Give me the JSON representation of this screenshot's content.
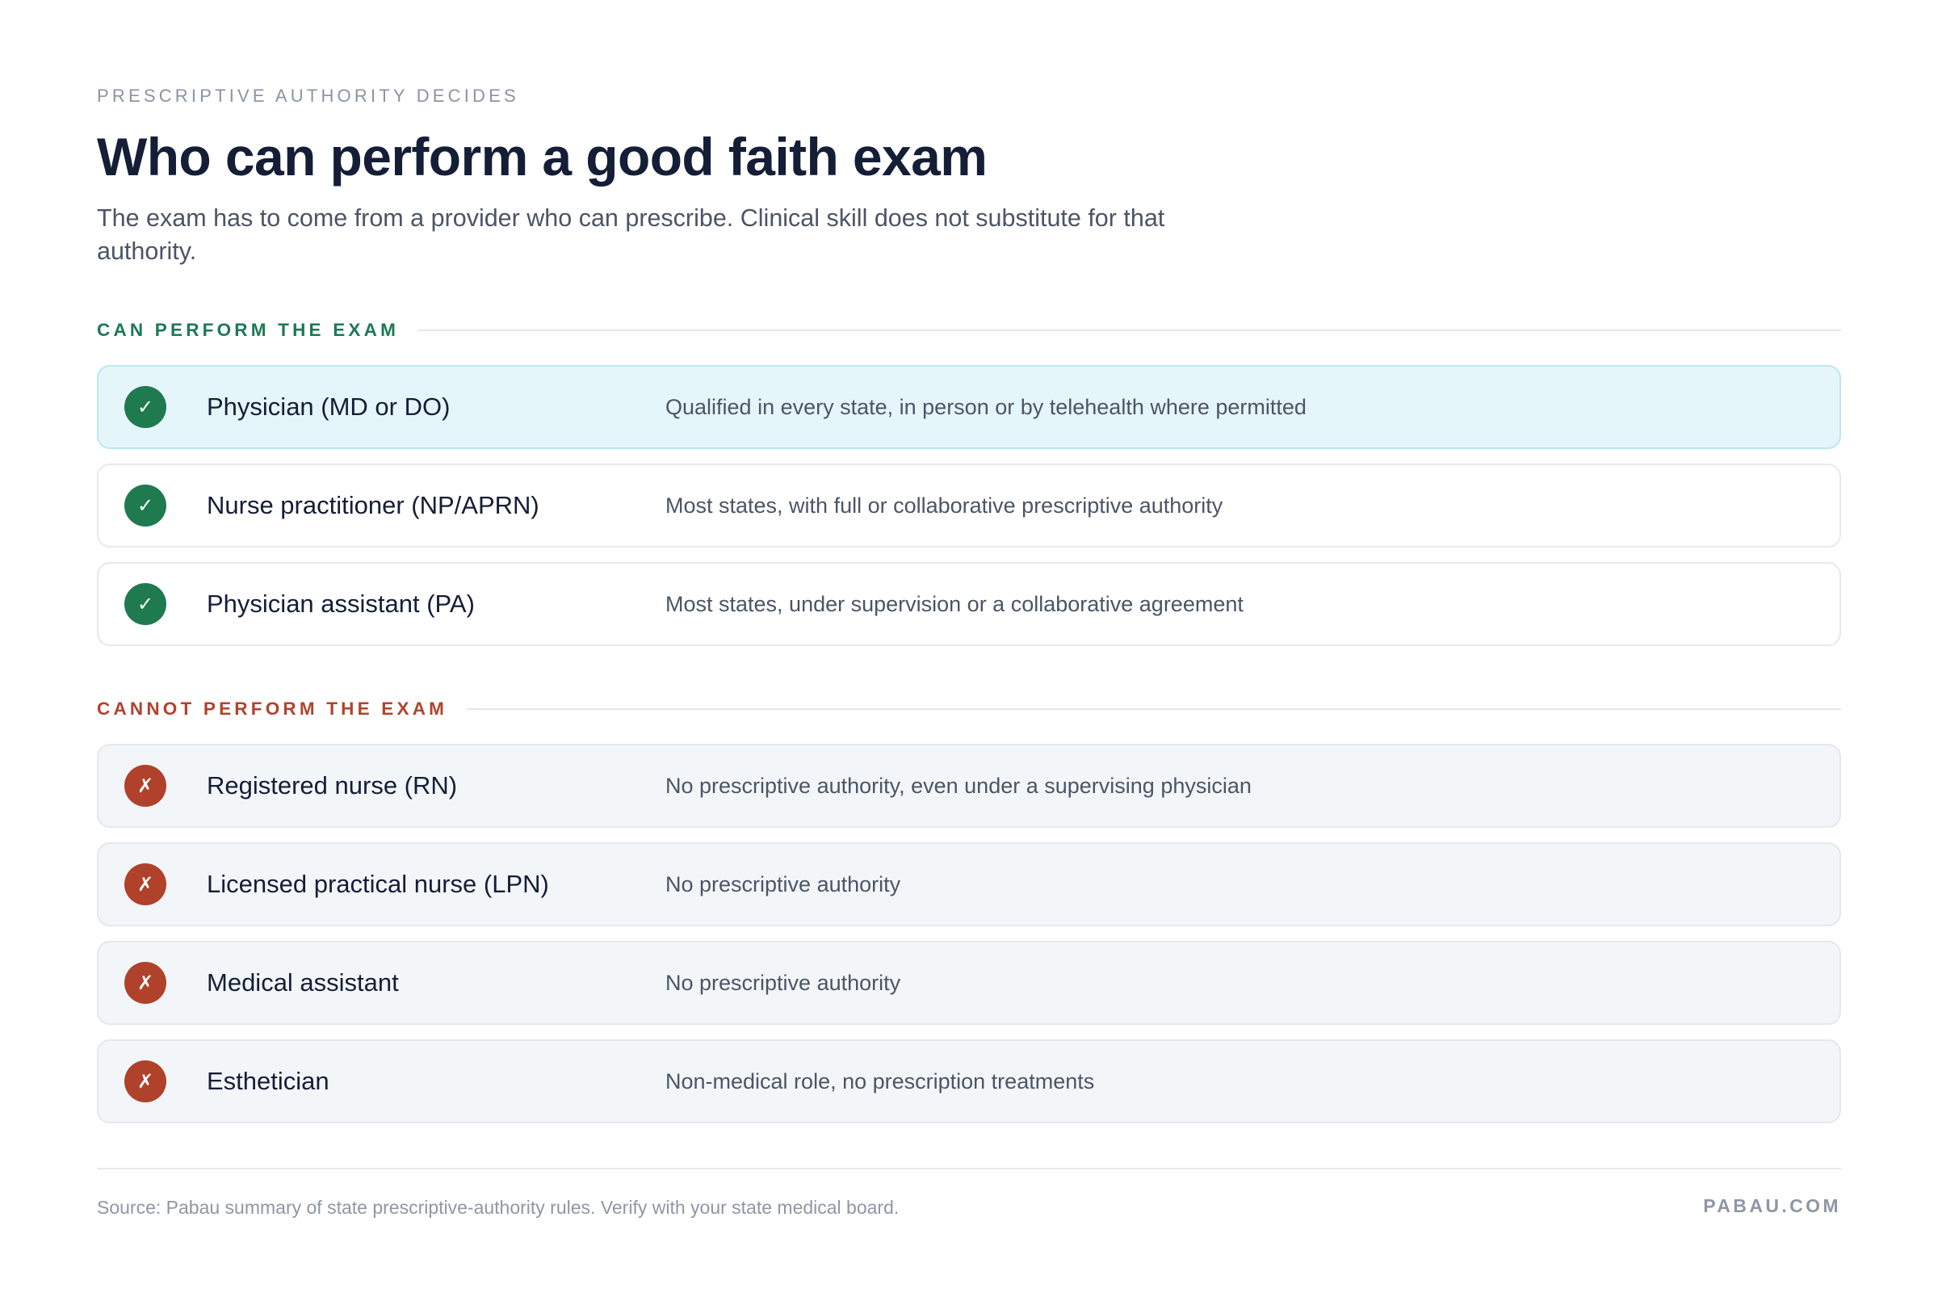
{
  "header": {
    "eyebrow": "PRESCRIPTIVE AUTHORITY DECIDES",
    "title": "Who can perform a good faith exam",
    "subtitle": "The exam has to come from a provider who can prescribe. Clinical skill does not substitute for that authority."
  },
  "can_section": {
    "label": "CAN PERFORM THE EXAM",
    "icon": "check-icon",
    "icon_glyph": "✓",
    "accent_color": "#1f7a50",
    "rows": [
      {
        "role": "Physician (MD or DO)",
        "detail": "Qualified in every state, in person or by telehealth where permitted",
        "highlighted": true
      },
      {
        "role": "Nurse practitioner (NP/APRN)",
        "detail": "Most states, with full or collaborative prescriptive authority",
        "highlighted": false
      },
      {
        "role": "Physician assistant (PA)",
        "detail": "Most states, under supervision or a collaborative agreement",
        "highlighted": false
      }
    ]
  },
  "cannot_section": {
    "label": "CANNOT PERFORM THE EXAM",
    "icon": "cross-icon",
    "icon_glyph": "✗",
    "accent_color": "#b0412b",
    "rows": [
      {
        "role": "Registered nurse (RN)",
        "detail": "No prescriptive authority, even under a supervising physician"
      },
      {
        "role": "Licensed practical nurse (LPN)",
        "detail": "No prescriptive authority"
      },
      {
        "role": "Medical assistant",
        "detail": "No prescriptive authority"
      },
      {
        "role": "Esthetician",
        "detail": "Non-medical role, no prescription treatments"
      }
    ]
  },
  "footer": {
    "source": "Source: Pabau summary of state prescriptive-authority rules. Verify with your state medical board.",
    "brand": "PABAU.COM"
  }
}
